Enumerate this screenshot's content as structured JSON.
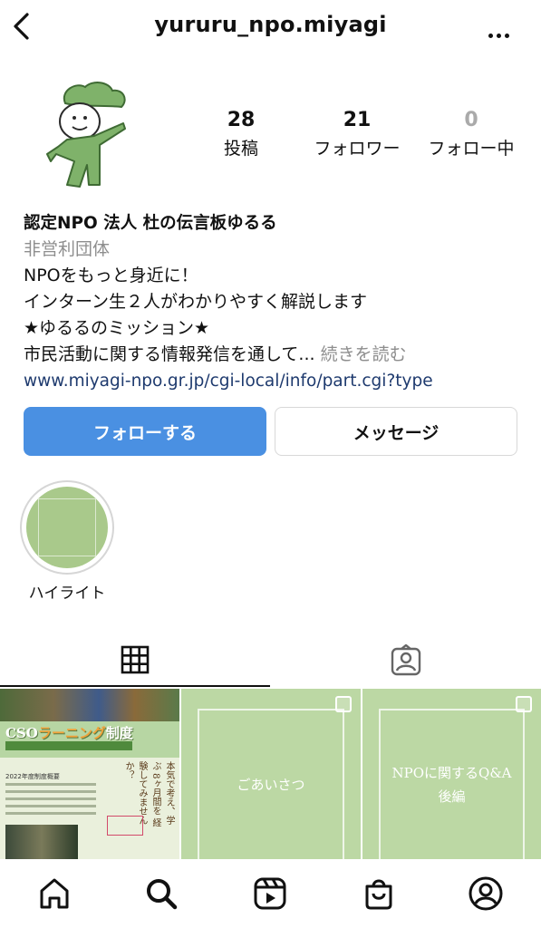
{
  "header": {
    "username": "yururu_npo.miyagi",
    "back_icon": "chevron-left-icon",
    "more_icon": "more-horizontal-icon"
  },
  "stats": [
    {
      "value": "28",
      "label": "投稿"
    },
    {
      "value": "21",
      "label": "フォロワー"
    },
    {
      "value": "0",
      "label": "フォロー中"
    }
  ],
  "bio": {
    "name": "認定NPO 法人 杜の伝言板ゆるる",
    "category": "非営利団体",
    "line1": "NPOをもっと身近に！",
    "line2": "インターン生２人がわかりやすく解説します",
    "line3": "★ゆるるのミッション★",
    "line4": "市民活動に関する情報発信を通して...",
    "more": "続きを読む",
    "link": "www.miyagi-npo.gr.jp/cgi-local/info/part.cgi?type"
  },
  "buttons": {
    "follow": "フォローする",
    "message": "メッセージ"
  },
  "highlight": {
    "label": "ハイライト"
  },
  "tabs": {
    "grid_icon": "grid-icon",
    "tagged_icon": "tagged-person-icon"
  },
  "posts": [
    {
      "title": "CSOラーニング制度",
      "title_plain": "CSO",
      "title_accent": "ラーニング",
      "title_tail": "制度",
      "year": "2022年度制度概要",
      "side": "本気で考え、学ぶ 8ヶ月間を 経験してみませんか？"
    },
    {
      "text": "ごあいさつ"
    },
    {
      "text_line1": "NPOに関するQ&A",
      "text_line2": "後編"
    }
  ],
  "colors": {
    "follow_button": "#4a90e2",
    "link": "#1e3a6e",
    "post_green": "#bcd8a4"
  },
  "bottom_nav": [
    "home-icon",
    "search-icon",
    "reels-icon",
    "shop-icon",
    "profile-icon"
  ]
}
